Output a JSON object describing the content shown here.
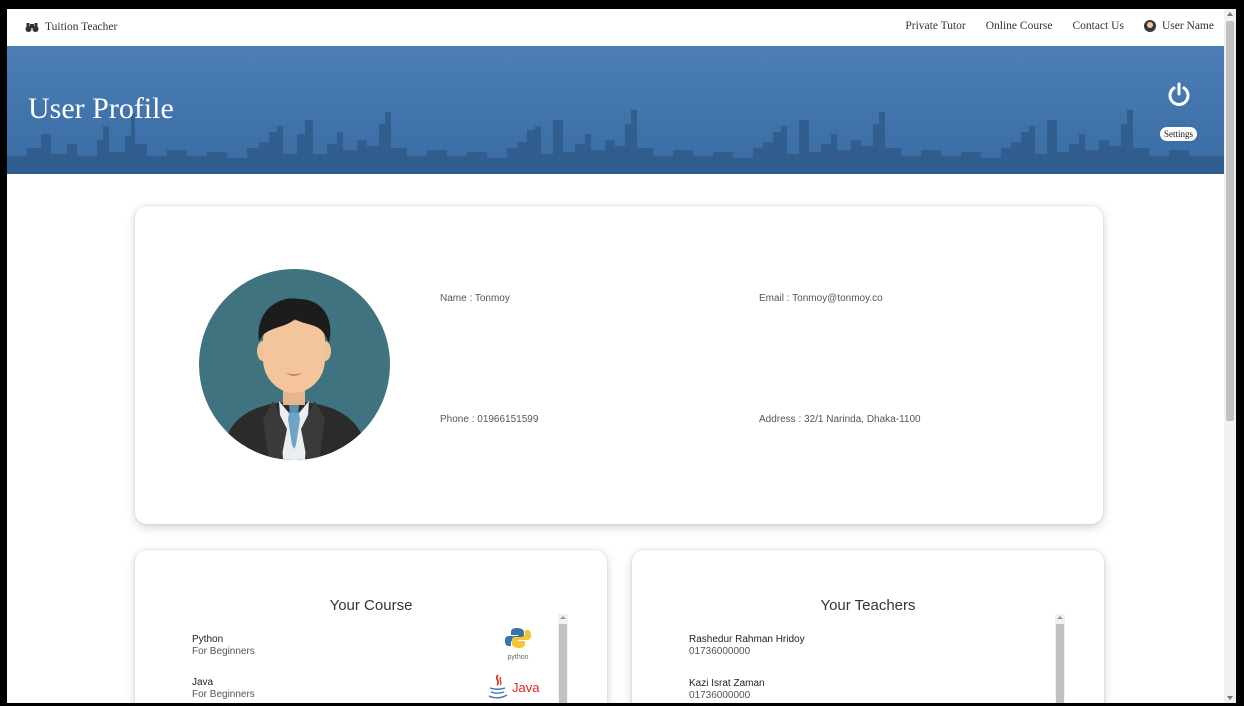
{
  "nav": {
    "brand": "Tuition Teacher",
    "links": [
      "Private Tutor",
      "Online Course",
      "Contact Us"
    ],
    "user_name": "User Name"
  },
  "banner": {
    "title": "User Profile",
    "settings_label": "Settings"
  },
  "profile": {
    "name": "Name : Tonmoy",
    "email": "Email : Tonmoy@tonmoy.co",
    "phone": "Phone : 01966151599",
    "address": "Address : 32/1 Narinda, Dhaka-1100"
  },
  "courses": {
    "title": "Your Course",
    "items": [
      {
        "name": "Python",
        "level": "For Beginners",
        "logo": "python-logo",
        "logo_text": "python"
      },
      {
        "name": "Java",
        "level": "For Beginners",
        "logo": "java-logo",
        "logo_text": "Java"
      }
    ]
  },
  "teachers": {
    "title": "Your Teachers",
    "items": [
      {
        "name": "Rashedur Rahman Hridoy",
        "phone": "01736000000"
      },
      {
        "name": "Kazi Israt Zaman",
        "phone": "01736000000"
      }
    ]
  },
  "colors": {
    "banner": "#3f73aa",
    "avatar_bg": "#3f7380"
  }
}
